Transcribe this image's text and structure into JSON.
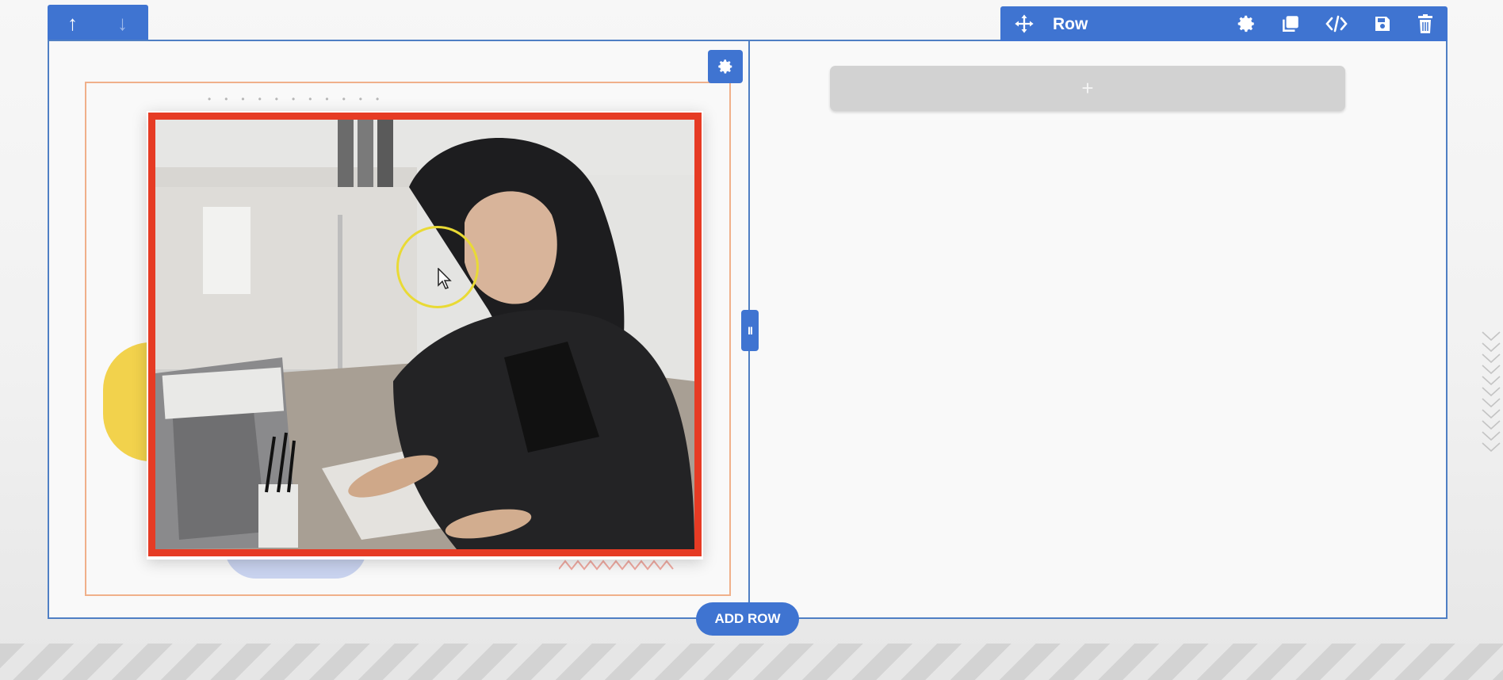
{
  "arrows": {
    "up_icon": "↑",
    "down_icon": "↓"
  },
  "toolbar": {
    "row_label": "Row",
    "tools": [
      "settings-icon",
      "duplicate-icon",
      "code-icon",
      "save-icon",
      "delete-icon"
    ]
  },
  "add_module": {
    "label": "+"
  },
  "add_row": {
    "label": "ADD ROW"
  },
  "resize_handle": {
    "label": "II"
  },
  "colors": {
    "accent": "#3f74d1",
    "image_border": "#e63b24",
    "cursor_highlight": "#e9da35",
    "frame": "#4f7fc4"
  }
}
